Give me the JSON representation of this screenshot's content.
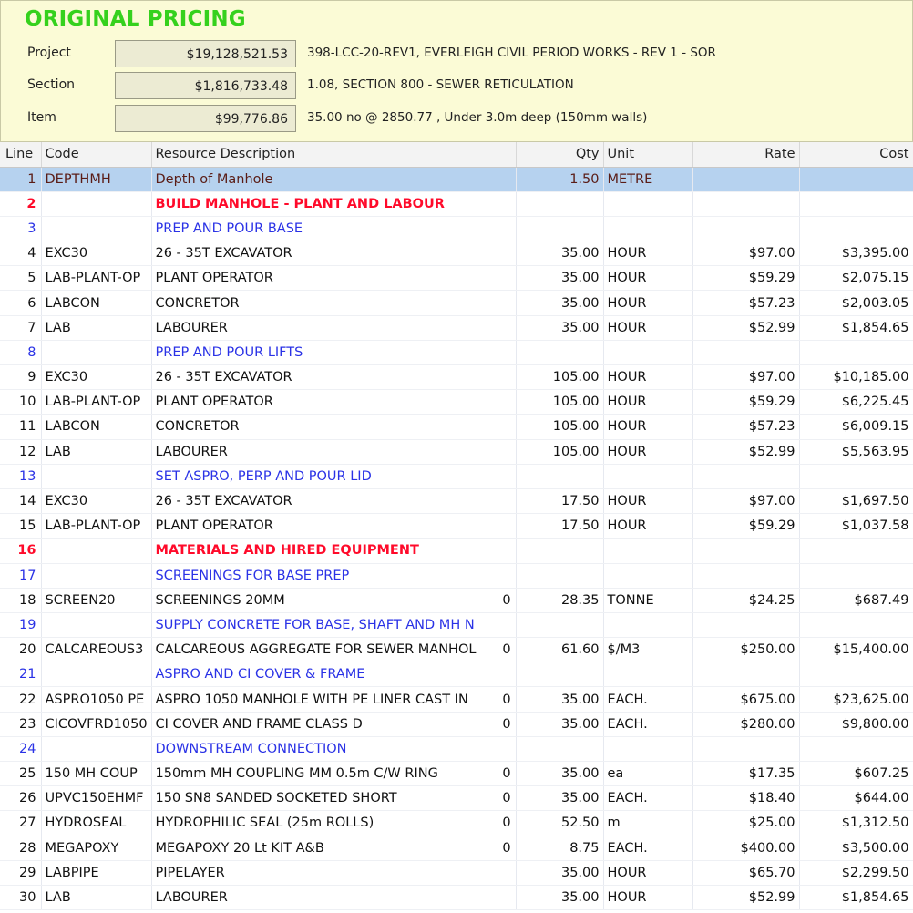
{
  "header": {
    "title": "ORIGINAL PRICING",
    "rows": [
      {
        "label": "Project",
        "value": "$19,128,521.53",
        "desc": "398-LCC-20-REV1, EVERLEIGH CIVIL PERIOD WORKS - REV 1 - SOR"
      },
      {
        "label": "Section",
        "value": "$1,816,733.48",
        "desc": "1.08, SECTION 800 - SEWER RETICULATION"
      },
      {
        "label": "Item",
        "value": "$99,776.86",
        "desc": "35.00 no @ 2850.77 ,  Under 3.0m deep (150mm walls)"
      }
    ]
  },
  "columns": {
    "line": "Line",
    "code": "Code",
    "desc": "Resource Description",
    "flag": "",
    "qty": "Qty",
    "unit": "Unit",
    "rate": "Rate",
    "cost": "Cost"
  },
  "rows": [
    {
      "type": "selected",
      "line": "1",
      "code": "DEPTHMH",
      "desc": "Depth of Manhole",
      "flag": "",
      "qty": "1.50",
      "unit": "METRE",
      "rate": "",
      "cost": ""
    },
    {
      "type": "heading-red",
      "line": "2",
      "code": "",
      "desc": "BUILD MANHOLE - PLANT AND LABOUR",
      "flag": "",
      "qty": "",
      "unit": "",
      "rate": "",
      "cost": ""
    },
    {
      "type": "heading-blue",
      "line": "3",
      "code": "",
      "desc": "PREP AND POUR BASE",
      "flag": "",
      "qty": "",
      "unit": "",
      "rate": "",
      "cost": ""
    },
    {
      "type": "normal",
      "line": "4",
      "code": "EXC30",
      "desc": "26 - 35T EXCAVATOR",
      "flag": "",
      "qty": "35.00",
      "unit": "HOUR",
      "rate": "$97.00",
      "cost": "$3,395.00"
    },
    {
      "type": "normal",
      "line": "5",
      "code": "LAB-PLANT-OP",
      "desc": "PLANT OPERATOR",
      "flag": "",
      "qty": "35.00",
      "unit": "HOUR",
      "rate": "$59.29",
      "cost": "$2,075.15"
    },
    {
      "type": "normal",
      "line": "6",
      "code": "LABCON",
      "desc": "CONCRETOR",
      "flag": "",
      "qty": "35.00",
      "unit": "HOUR",
      "rate": "$57.23",
      "cost": "$2,003.05"
    },
    {
      "type": "normal",
      "line": "7",
      "code": "LAB",
      "desc": "LABOURER",
      "flag": "",
      "qty": "35.00",
      "unit": "HOUR",
      "rate": "$52.99",
      "cost": "$1,854.65"
    },
    {
      "type": "heading-blue",
      "line": "8",
      "code": "",
      "desc": "PREP AND POUR LIFTS",
      "flag": "",
      "qty": "",
      "unit": "",
      "rate": "",
      "cost": ""
    },
    {
      "type": "normal",
      "line": "9",
      "code": "EXC30",
      "desc": "26 - 35T EXCAVATOR",
      "flag": "",
      "qty": "105.00",
      "unit": "HOUR",
      "rate": "$97.00",
      "cost": "$10,185.00"
    },
    {
      "type": "normal",
      "line": "10",
      "code": "LAB-PLANT-OP",
      "desc": "PLANT OPERATOR",
      "flag": "",
      "qty": "105.00",
      "unit": "HOUR",
      "rate": "$59.29",
      "cost": "$6,225.45"
    },
    {
      "type": "normal",
      "line": "11",
      "code": "LABCON",
      "desc": "CONCRETOR",
      "flag": "",
      "qty": "105.00",
      "unit": "HOUR",
      "rate": "$57.23",
      "cost": "$6,009.15"
    },
    {
      "type": "normal",
      "line": "12",
      "code": "LAB",
      "desc": "LABOURER",
      "flag": "",
      "qty": "105.00",
      "unit": "HOUR",
      "rate": "$52.99",
      "cost": "$5,563.95"
    },
    {
      "type": "heading-blue",
      "line": "13",
      "code": "",
      "desc": "SET ASPRO, PERP AND POUR LID",
      "flag": "",
      "qty": "",
      "unit": "",
      "rate": "",
      "cost": ""
    },
    {
      "type": "normal",
      "line": "14",
      "code": "EXC30",
      "desc": "26 - 35T EXCAVATOR",
      "flag": "",
      "qty": "17.50",
      "unit": "HOUR",
      "rate": "$97.00",
      "cost": "$1,697.50"
    },
    {
      "type": "normal",
      "line": "15",
      "code": "LAB-PLANT-OP",
      "desc": "PLANT OPERATOR",
      "flag": "",
      "qty": "17.50",
      "unit": "HOUR",
      "rate": "$59.29",
      "cost": "$1,037.58"
    },
    {
      "type": "heading-red",
      "line": "16",
      "code": "",
      "desc": "MATERIALS AND HIRED EQUIPMENT",
      "flag": "",
      "qty": "",
      "unit": "",
      "rate": "",
      "cost": ""
    },
    {
      "type": "heading-blue",
      "line": "17",
      "code": "",
      "desc": "SCREENINGS FOR BASE PREP",
      "flag": "",
      "qty": "",
      "unit": "",
      "rate": "",
      "cost": ""
    },
    {
      "type": "normal",
      "line": "18",
      "code": "SCREEN20",
      "desc": "SCREENINGS 20MM",
      "flag": "0",
      "qty": "28.35",
      "unit": "TONNE",
      "rate": "$24.25",
      "cost": "$687.49"
    },
    {
      "type": "heading-blue",
      "line": "19",
      "code": "",
      "desc": "SUPPLY CONCRETE FOR BASE, SHAFT AND MH N",
      "flag": "",
      "qty": "",
      "unit": "",
      "rate": "",
      "cost": ""
    },
    {
      "type": "normal",
      "line": "20",
      "code": "CALCAREOUS3",
      "desc": "CALCAREOUS AGGREGATE FOR SEWER MANHOL",
      "flag": "0",
      "qty": "61.60",
      "unit": "$/M3",
      "rate": "$250.00",
      "cost": "$15,400.00"
    },
    {
      "type": "heading-blue",
      "line": "21",
      "code": "",
      "desc": "ASPRO AND CI COVER & FRAME",
      "flag": "",
      "qty": "",
      "unit": "",
      "rate": "",
      "cost": ""
    },
    {
      "type": "normal",
      "line": "22",
      "code": "ASPRO1050 PE",
      "desc": "ASPRO 1050 MANHOLE WITH PE LINER CAST IN",
      "flag": "0",
      "qty": "35.00",
      "unit": "EACH.",
      "rate": "$675.00",
      "cost": "$23,625.00"
    },
    {
      "type": "normal",
      "line": "23",
      "code": "CICOVFRD1050",
      "desc": "CI COVER AND FRAME CLASS D",
      "flag": "0",
      "qty": "35.00",
      "unit": "EACH.",
      "rate": "$280.00",
      "cost": "$9,800.00"
    },
    {
      "type": "heading-blue",
      "line": "24",
      "code": "",
      "desc": "DOWNSTREAM CONNECTION",
      "flag": "",
      "qty": "",
      "unit": "",
      "rate": "",
      "cost": ""
    },
    {
      "type": "normal",
      "line": "25",
      "code": "150 MH COUP",
      "desc": "150mm MH COUPLING MM 0.5m C/W RING",
      "flag": "0",
      "qty": "35.00",
      "unit": "ea",
      "rate": "$17.35",
      "cost": "$607.25"
    },
    {
      "type": "normal",
      "line": "26",
      "code": "UPVC150EHMF",
      "desc": "150 SN8  SANDED SOCKETED SHORT",
      "flag": "0",
      "qty": "35.00",
      "unit": "EACH.",
      "rate": "$18.40",
      "cost": "$644.00"
    },
    {
      "type": "normal",
      "line": "27",
      "code": "HYDROSEAL",
      "desc": "HYDROPHILIC SEAL (25m ROLLS)",
      "flag": "0",
      "qty": "52.50",
      "unit": "m",
      "rate": "$25.00",
      "cost": "$1,312.50"
    },
    {
      "type": "normal",
      "line": "28",
      "code": "MEGAPOXY",
      "desc": "MEGAPOXY 20 Lt KIT A&B",
      "flag": "0",
      "qty": "8.75",
      "unit": "EACH.",
      "rate": "$400.00",
      "cost": "$3,500.00"
    },
    {
      "type": "normal",
      "line": "29",
      "code": "LABPIPE",
      "desc": "PIPELAYER",
      "flag": "",
      "qty": "35.00",
      "unit": "HOUR",
      "rate": "$65.70",
      "cost": "$2,299.50"
    },
    {
      "type": "normal",
      "line": "30",
      "code": "LAB",
      "desc": "LABOURER",
      "flag": "",
      "qty": "35.00",
      "unit": "HOUR",
      "rate": "$52.99",
      "cost": "$1,854.65"
    }
  ]
}
